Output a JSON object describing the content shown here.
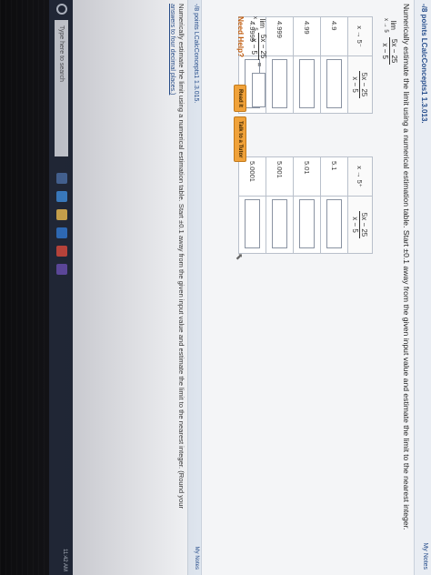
{
  "question": {
    "points_label": "-/8 points",
    "problem_code": "LCalcConcepts1 1.3.013.",
    "notes_label": "My Notes",
    "instruction": "Numerically estimate the limit using a numerical estimation table. Start ±0.1 away from the given input value and estimate the limit to the nearest integer.",
    "limit_sub": "x → 5",
    "limit_numerator": "5x − 25",
    "limit_denominator": "x − 5"
  },
  "left_table": {
    "col_x_header": "x → 5⁻",
    "col_f_num": "5x − 25",
    "col_f_den": "x − 5",
    "rows": [
      "4.9",
      "4.99",
      "4.999",
      "4.9999"
    ]
  },
  "right_table": {
    "col_x_header": "x → 5⁺",
    "col_f_num": "5x − 25",
    "col_f_den": "x − 5",
    "rows": [
      "5.1",
      "5.01",
      "5.001",
      "5.0001"
    ]
  },
  "limit_question": {
    "lim_label": "lim",
    "sub": "x → 5",
    "numerator": "5x − 25",
    "denominator": "x − 5",
    "equals": "="
  },
  "help": {
    "label": "Need Help?",
    "read_it": "Read It",
    "talk_tutor": "Talk to a Tutor"
  },
  "next_question": {
    "points_label": "-/8 points",
    "problem_code": "LCalcConcepts1 1.3.015.",
    "notes_label": "My Notes",
    "text": "Numerically estimate the limit using a numerical estimation table. Start ±0.1 away from the given input value and estimate the limit to the nearest integer. (Round your",
    "sub": "answers to four decimal places.)"
  },
  "taskbar": {
    "search_placeholder": "Type here to search",
    "time": "11:42 AM"
  },
  "colors": {
    "link_blue": "#274e8c",
    "help_orange": "#c05a0b",
    "button_orange": "#f0a23a"
  }
}
